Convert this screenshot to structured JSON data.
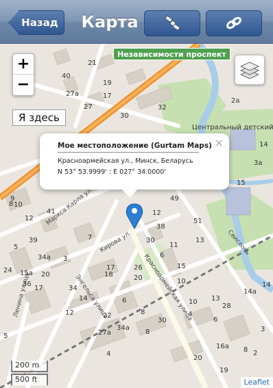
{
  "navbar": {
    "back_label": "Назад",
    "title": "Карта"
  },
  "map": {
    "street_badge": "Независимости проспект",
    "zoom_in": "+",
    "zoom_out": "−",
    "locate_label": "Я здесь",
    "popup": {
      "title": "Мое местоположение (Gurtam Maps)",
      "address": "Красноармейская ул., Минск, Беларусь",
      "coords": "N 53° 53.9999' : E 027° 34.0000'",
      "close": "×"
    },
    "scale_metric": "200 m",
    "scale_imperial": "500 ft",
    "attribution": "Leaflet",
    "labels": {
      "kindergarten": "Центральный детский",
      "street_karla": "Маркса Карла ул.",
      "street_kirova": "Кирова ул.",
      "street_krasno": "Красноармейская улица",
      "street_engelsa": "Энгельса улица",
      "street_lenina": "Ленина улица",
      "street_svisloch": "Свислочь"
    },
    "numbers": [
      "21",
      "40",
      "19",
      "27a",
      "17",
      "27",
      "30",
      "32",
      "2a",
      "3a",
      "14",
      "15",
      "8",
      "9",
      "41",
      "10",
      "12",
      "12",
      "49",
      "51",
      "7",
      "38",
      "30",
      "11",
      "13",
      "5",
      "39",
      "34a",
      "3",
      "24",
      "15a",
      "20",
      "36",
      "34",
      "17",
      "18",
      "17",
      "14",
      "26",
      "6",
      "15",
      "20",
      "10",
      "14a",
      "14",
      "13",
      "10",
      "12",
      "6",
      "8",
      "30",
      "22",
      "34a",
      "27a",
      "8",
      "4",
      "4",
      "6",
      "28",
      "16a",
      "20",
      "19",
      "8",
      "2",
      "3",
      "5"
    ]
  },
  "colors": {
    "navbar_top": "#9fb2c9",
    "navbar_bottom": "#5f7a9d",
    "button_blue": "#2f5791",
    "main_road": "#f2922c",
    "river": "#a8cde8",
    "park": "#c7e0b2",
    "map_background": "#eae6df",
    "marker": "#2b7ed1"
  },
  "icons": {
    "nav_button_1": "satellite-icon",
    "nav_button_2": "location-link-icon",
    "layers": "layers-icon",
    "marker": "map-pin-icon"
  }
}
